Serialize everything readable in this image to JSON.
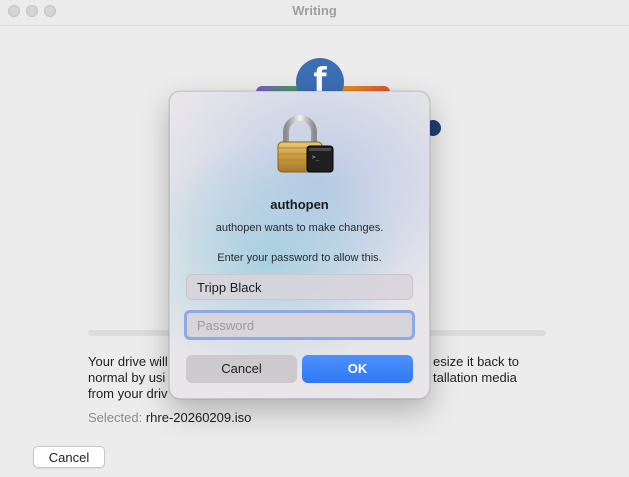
{
  "window": {
    "title": "Writing"
  },
  "main": {
    "info_text": "Your drive will be resized and restored. You can resize it back to normal by using the Restore option, or re-create installation media from your drive.",
    "info_visible_lines": [
      "Your drive will",
      "normal by usi",
      "from your driv"
    ],
    "info_right_lines": [
      "esize it back to",
      "tallation media"
    ],
    "selected_label": "Selected:",
    "selected_file": "rhre-20260209.iso",
    "cancel_label": "Cancel"
  },
  "dialog": {
    "icon": "lock-icon",
    "title": "authopen",
    "message": "authopen wants to make changes.",
    "prompt": "Enter your password to allow this.",
    "username_value": "Tripp Black",
    "password_placeholder": "Password",
    "cancel_label": "Cancel",
    "ok_label": "OK"
  },
  "colors": {
    "accent": "#3b82f6",
    "focus_ring": "#8ea9e6",
    "logo_blue": "#3c6eb4"
  }
}
